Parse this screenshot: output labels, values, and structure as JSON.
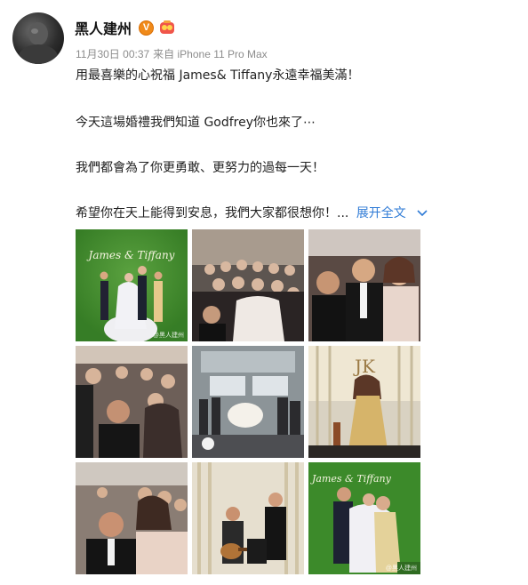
{
  "author": {
    "name": "黑人建州",
    "verified_badge": "V",
    "avatar_icon": "avatar-photo"
  },
  "meta": {
    "timestamp": "11月30日 00:37",
    "source": "来自 iPhone 11 Pro Max"
  },
  "post": {
    "lines": [
      "用最喜樂的心祝福 James& Tiffany永遠幸福美滿！",
      "今天這場婚禮我們知道 Godfrey你也來了⋯",
      "我們都會為了你更勇敢、更努力的過每一天！",
      "希望你在天上能得到安息，我們大家都很想你！..."
    ],
    "expand_label": "展开全文"
  },
  "photos": [
    {
      "icon": "wedding-couple-photo",
      "overlay": "James & Tiffany",
      "watermark": "@黑人建州"
    },
    {
      "icon": "group-selfie-photo"
    },
    {
      "icon": "guests-portrait-photo"
    },
    {
      "icon": "group-selfie-photo-2"
    },
    {
      "icon": "reception-hall-photo"
    },
    {
      "icon": "singer-stage-photo"
    },
    {
      "icon": "selfie-guests-photo"
    },
    {
      "icon": "guitar-performance-photo"
    },
    {
      "icon": "couple-hug-photo",
      "overlay": "James & Tiffany",
      "watermark": "@黑人建州"
    }
  ],
  "colors": {
    "link": "#2f7bd6",
    "meta": "#8c8c8c",
    "badge": "#f08a1a",
    "wedding_green": "#3f8d2c"
  }
}
